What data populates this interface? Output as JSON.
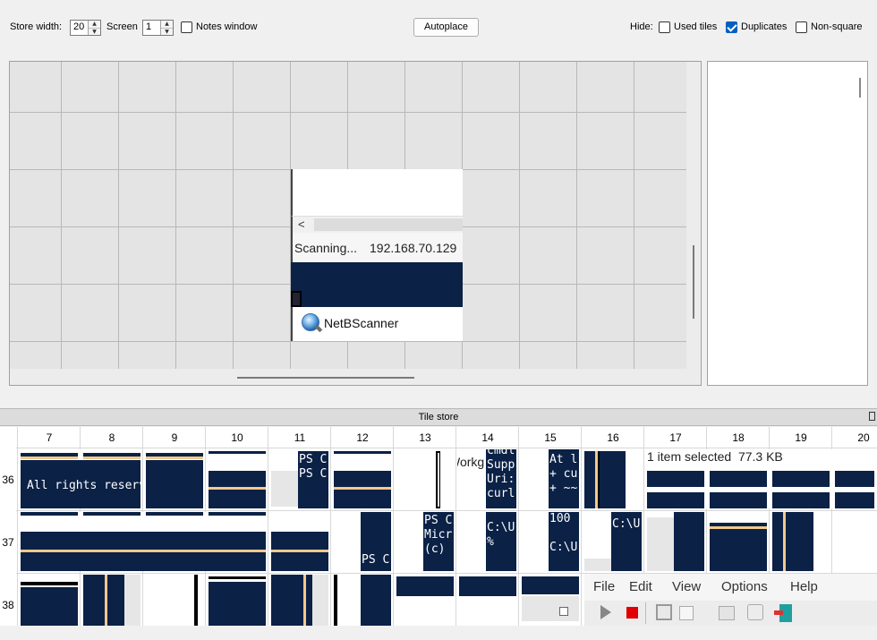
{
  "toolbar": {
    "store_width_label": "Store width:",
    "store_width_value": "20",
    "screen_label": "Screen",
    "screen_value": "1",
    "notes_window_label": "Notes window",
    "notes_window_checked": false,
    "autoplace_label": "Autoplace",
    "hide_label": "Hide:",
    "used_tiles_label": "Used tiles",
    "used_tiles_checked": false,
    "duplicates_label": "Duplicates",
    "duplicates_checked": true,
    "non_square_label": "Non-square",
    "non_square_checked": false
  },
  "screen": {
    "scan_label": "Scanning...",
    "scan_ip": "192.168.70.129",
    "app_name": "NetBScanner",
    "scroll_left_glyph": "<"
  },
  "store": {
    "title": "Tile store",
    "columns": [
      "7",
      "8",
      "9",
      "10",
      "11",
      "12",
      "13",
      "14",
      "15",
      "16",
      "17",
      "18",
      "19",
      "20"
    ],
    "rows": [
      "36",
      "37",
      "38"
    ],
    "tile_text": {
      "all_rights": "All rights reserved.",
      "ps_c_1": "PS C\nPS C",
      "ps_cmdl": "cmdl",
      "workg": "Workg",
      "cmdl_supp": "cmdl\nSupp\nUri:\ncurl",
      "at_l": "At l\n+ cu\n+ ~~",
      "item_selected": "1 item selected  77.3 KB",
      "ps_c_2": "PS C",
      "ps_micr": "PS C\nMicr\n(c)",
      "c_u_pct": "C:\\U\n%",
      "hundred": "100\n\nC:\\U",
      "c_u": "C:\\U",
      "menu_file": "File",
      "menu_edit": "Edit",
      "menu_view": "View",
      "menu_options": "Options",
      "menu_help": "Help"
    }
  },
  "colors": {
    "navy": "#0b2146",
    "gold": "#f3c98b",
    "checkbox_accent": "#0060c0",
    "grid_bg": "#e4e4e4"
  }
}
